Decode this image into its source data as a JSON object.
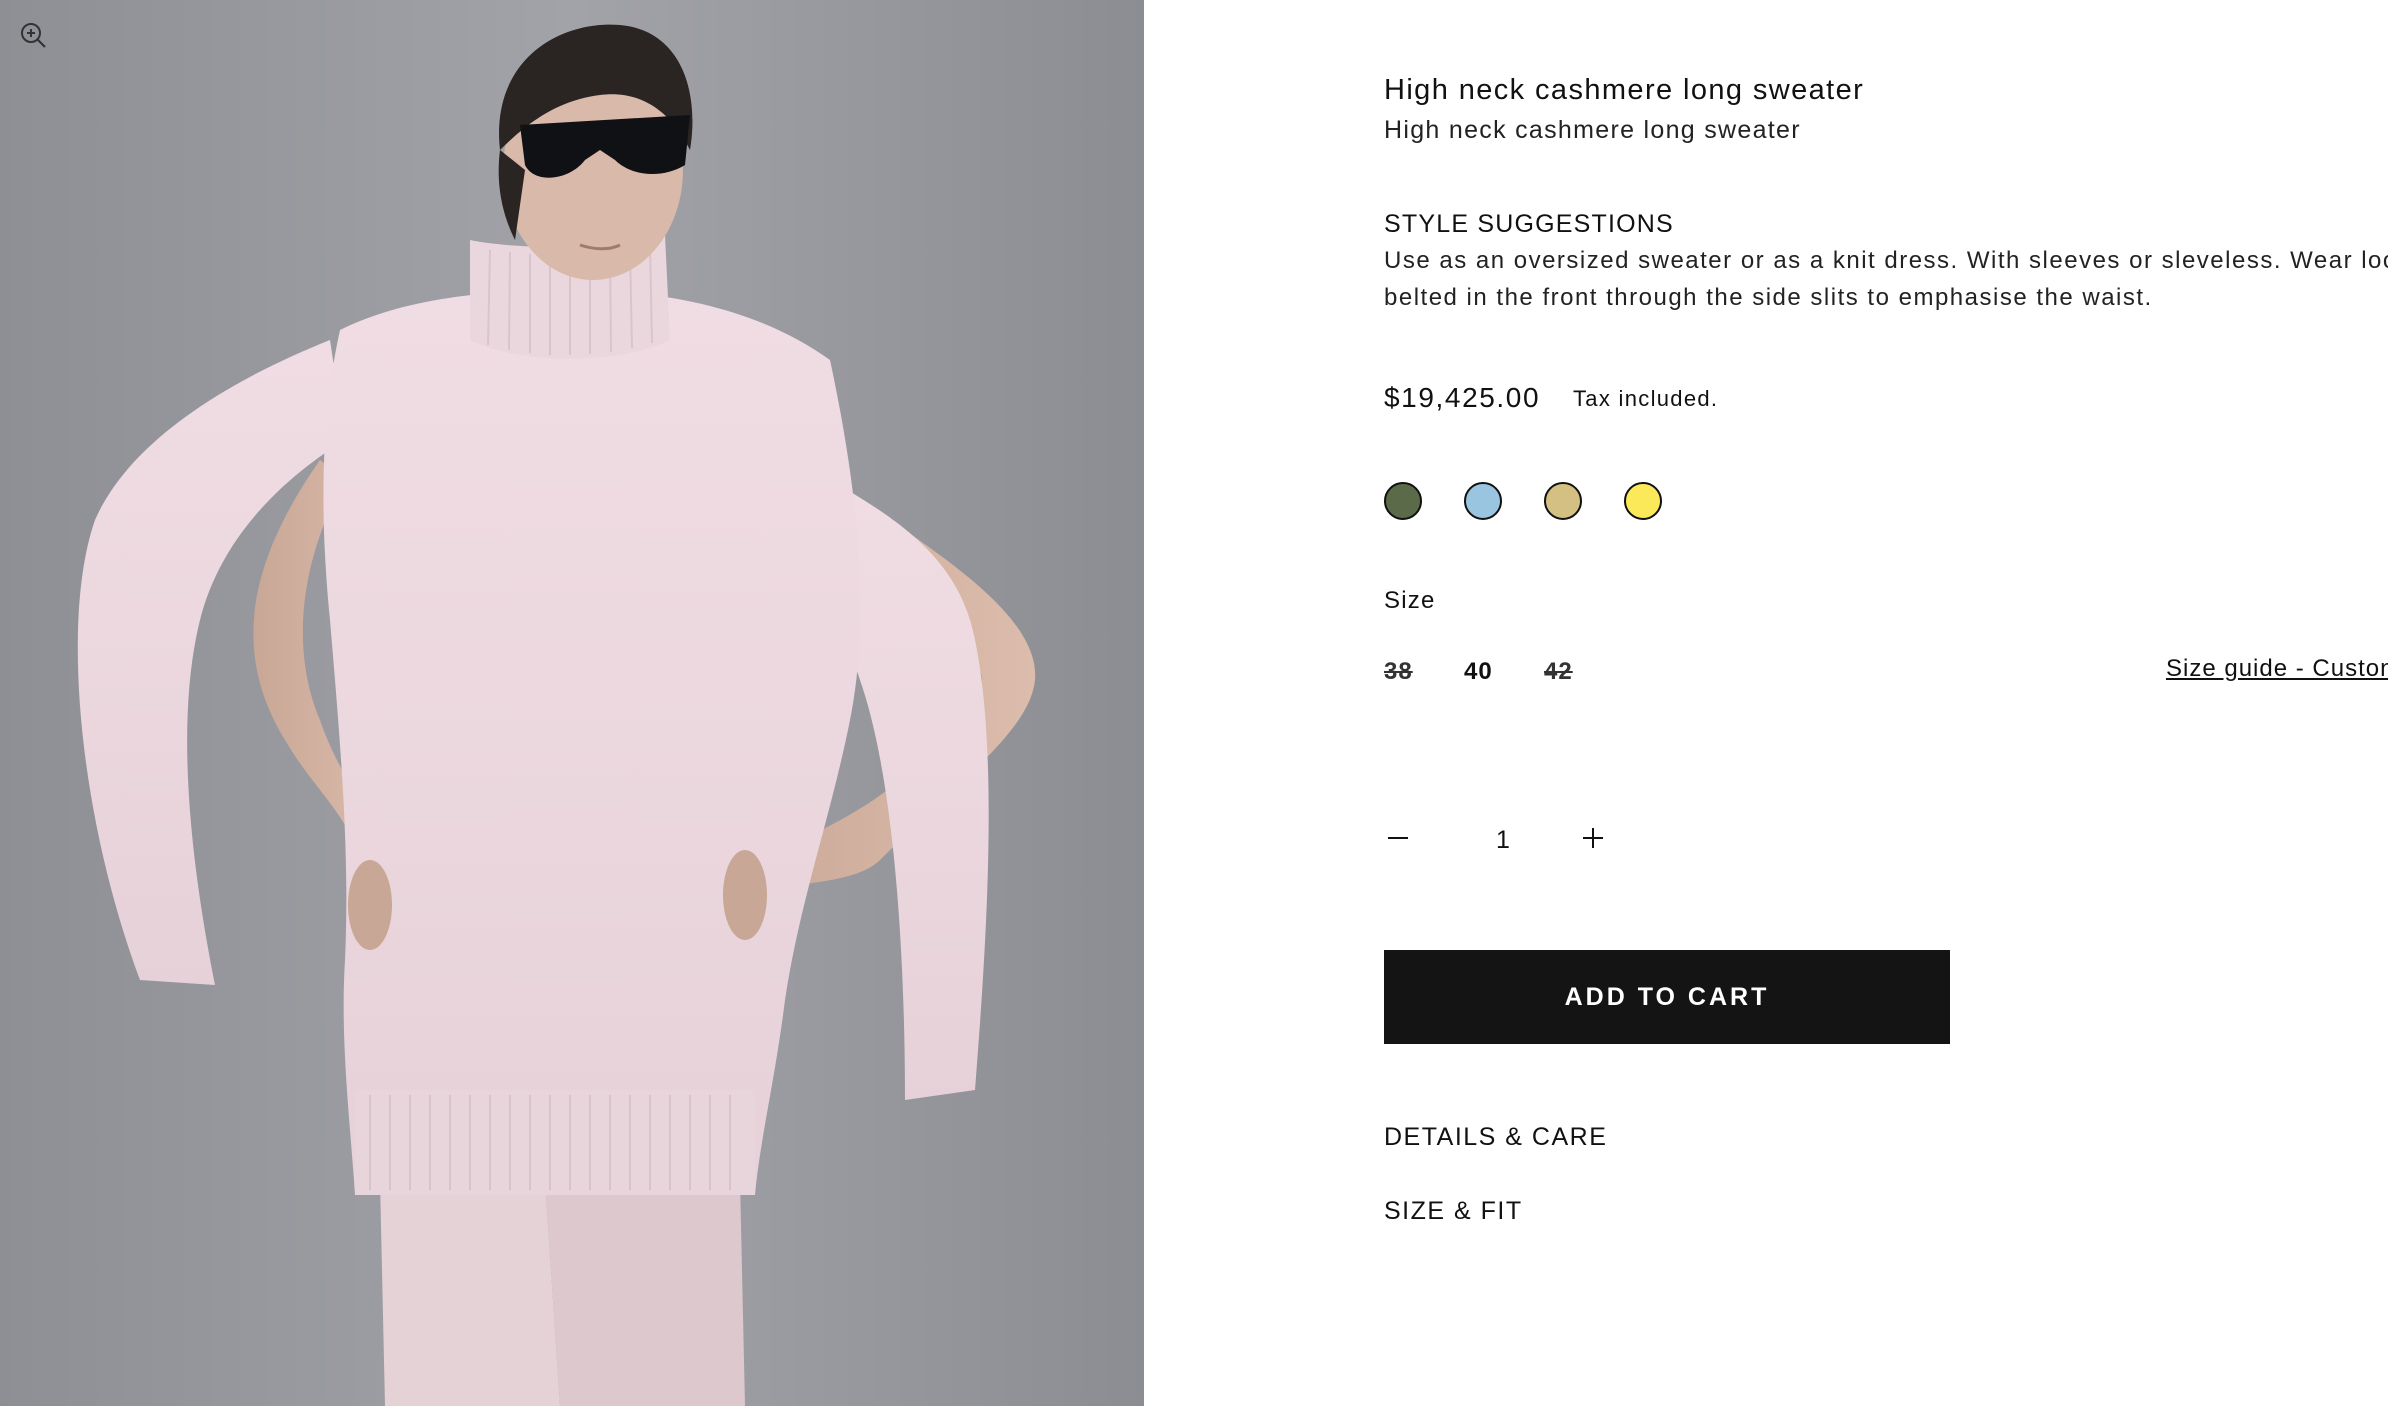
{
  "gallery": {
    "zoom_icon": "zoom-in-icon",
    "image_subject": "model-in-pink-high-neck-knit"
  },
  "product": {
    "title": "High neck cashmere long sweater",
    "subtitle": "High neck cashmere long sweater",
    "style_heading": "STYLE SUGGESTIONS",
    "style_text_line1": "Use as an oversized sweater or as a knit dress. With sleeves or sleveless. Wear loos",
    "style_text_line2": "belted in the front through the side slits to emphasise the waist.",
    "price": "$19,425.00",
    "tax_note": "Tax included."
  },
  "colors": [
    {
      "name": "olive",
      "hex": "#5b6a48"
    },
    {
      "name": "light-blue",
      "hex": "#9ac5e0"
    },
    {
      "name": "sand",
      "hex": "#d4c083"
    },
    {
      "name": "yellow",
      "hex": "#fbe95a"
    }
  ],
  "size": {
    "label": "Size",
    "options": [
      {
        "value": "38",
        "available": false
      },
      {
        "value": "40",
        "available": true
      },
      {
        "value": "42",
        "available": false
      }
    ],
    "guide_link": "Size guide - Custon"
  },
  "quantity": {
    "value": "1",
    "minus_icon": "minus-icon",
    "plus_icon": "plus-icon"
  },
  "cart": {
    "button_label": "ADD TO CART"
  },
  "accordions": {
    "details_label": "DETAILS & CARE",
    "size_fit_label": "SIZE & FIT"
  }
}
